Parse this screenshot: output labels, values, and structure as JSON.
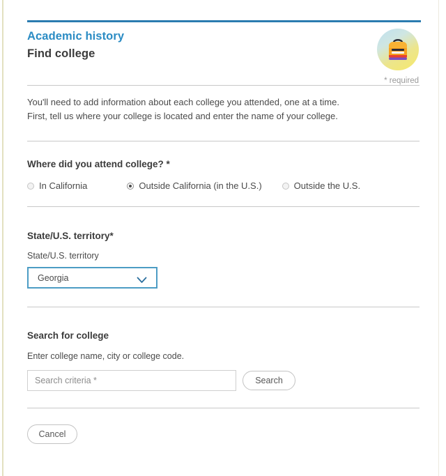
{
  "window": {
    "title": "Find college"
  },
  "header": {
    "eyebrow": "Academic history",
    "title": "Find college",
    "badge_icon": "backpack-icon",
    "required_note": "* required"
  },
  "intro": {
    "line1": "You'll need to add information about each college you attended, one at a time.",
    "line2": "First, tell us where your college is located and enter the name of your college."
  },
  "location_question": {
    "label": "Where did you attend college? *",
    "options": [
      {
        "label": "In California",
        "selected": false
      },
      {
        "label": "Outside California (in the U.S.)",
        "selected": true
      },
      {
        "label": "Outside the U.S.",
        "selected": false
      }
    ]
  },
  "state_section": {
    "heading": "State/U.S. territory*",
    "field_label": "State/U.S. territory",
    "selected_value": "Georgia",
    "chevron_icon": "chevron-down-icon"
  },
  "search_section": {
    "heading": "Search for college",
    "hint": "Enter college name, city or college code.",
    "input_placeholder": "Search criteria *",
    "input_value": "",
    "search_button": "Search"
  },
  "footer": {
    "cancel_button": "Cancel"
  },
  "colors": {
    "accent_blue": "#2b8cc4",
    "rule_blue": "#2b7cb0",
    "select_border": "#4c9cc4",
    "divider": "#c8c8c8",
    "text": "#4a4a4a",
    "muted": "#9a9a9a"
  }
}
